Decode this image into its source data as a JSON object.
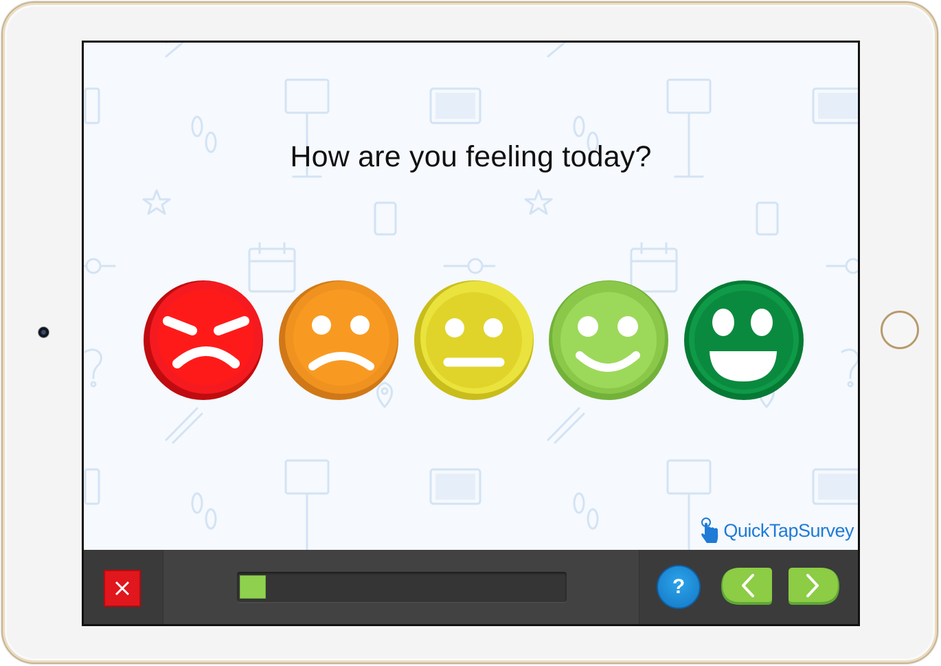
{
  "survey": {
    "question": "How are you feeling today?",
    "brand": "QuickTapSurvey",
    "progress": 0.08
  },
  "faces": [
    {
      "name": "angry",
      "color": "#e8141a"
    },
    {
      "name": "sad",
      "color": "#f29322"
    },
    {
      "name": "neutral",
      "color": "#e2d52a"
    },
    {
      "name": "happy",
      "color": "#8dcc45"
    },
    {
      "name": "very-happy",
      "color": "#0a8a3f"
    }
  ],
  "controls": {
    "close_icon": "close-icon",
    "help_label": "?",
    "back_icon": "chevron-left-icon",
    "next_icon": "chevron-right-icon",
    "accent": "#8dcc45",
    "close_color": "#e0171c",
    "help_color": "#1c8fd8"
  }
}
